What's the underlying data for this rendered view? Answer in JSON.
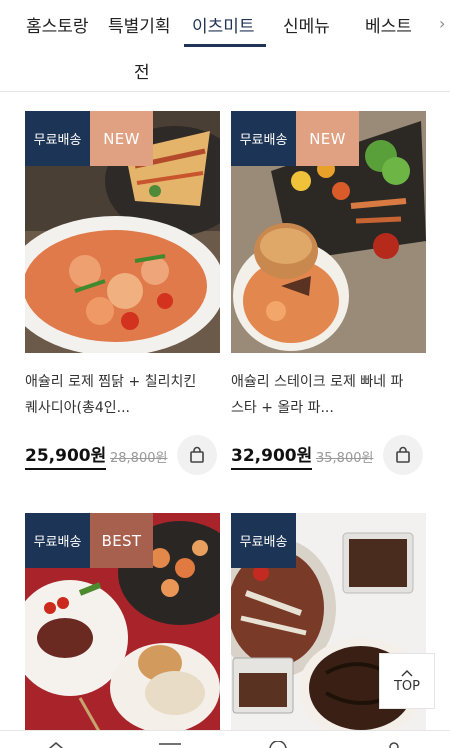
{
  "tabs": [
    {
      "label": "홈스토랑"
    },
    {
      "label": "특별기획"
    },
    {
      "label": "이츠미트"
    },
    {
      "label": "신메뉴"
    },
    {
      "label": "베스트"
    }
  ],
  "tab_wrap": "전",
  "active_tab": "이츠미트",
  "products": [
    {
      "badges": [
        "무료배송",
        "NEW"
      ],
      "title_line1": "애슐리 로제 찜닭 + 칠리치킨",
      "title_line2": "퀘사디아(총4인...",
      "price": "25,900원",
      "original_price": "28,800원"
    },
    {
      "badges": [
        "무료배송",
        "NEW"
      ],
      "title_line1": "애슐리 스테이크 로제 빠네 파",
      "title_line2": "스타 + 올라 파...",
      "price": "32,900원",
      "original_price": "35,800원"
    },
    {
      "badges": [
        "무료배송",
        "BEST"
      ]
    },
    {
      "badges": [
        "무료배송"
      ]
    }
  ],
  "top_button": {
    "label": "TOP"
  },
  "colors": {
    "navy": "#1c3456",
    "new_badge": "#e0a183",
    "best_badge": "#a8604e",
    "cart_bg": "#f1f1f1"
  }
}
